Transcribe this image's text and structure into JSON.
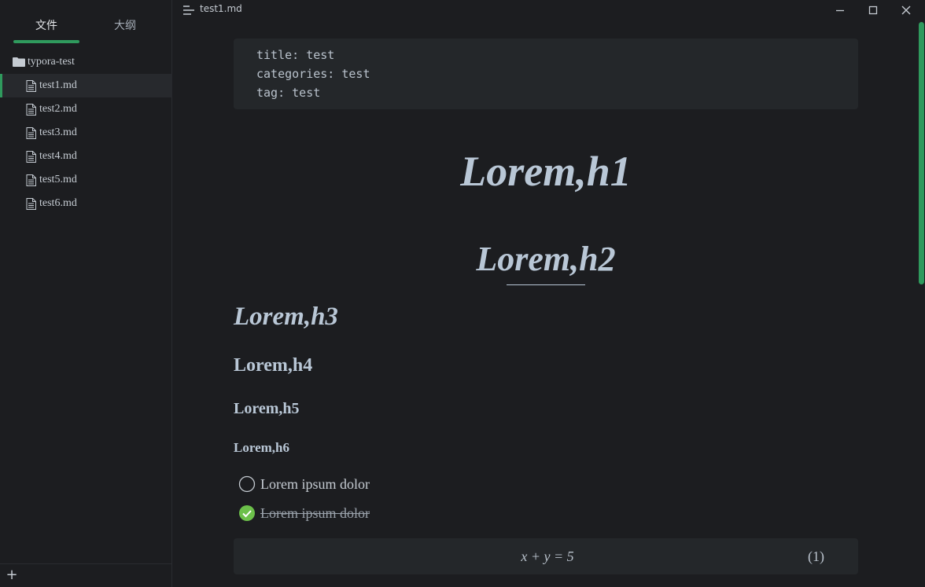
{
  "sidebar": {
    "tabs": {
      "files": "文件",
      "outline": "大纲"
    },
    "folder": {
      "name": "typora-test",
      "icon": "folder-icon"
    },
    "files": [
      {
        "name": "test1.md",
        "active": true
      },
      {
        "name": "test2.md",
        "active": false
      },
      {
        "name": "test3.md",
        "active": false
      },
      {
        "name": "test4.md",
        "active": false
      },
      {
        "name": "test5.md",
        "active": false
      },
      {
        "name": "test6.md",
        "active": false
      }
    ],
    "add_label": "+"
  },
  "titlebar": {
    "title": "test1.md"
  },
  "document": {
    "frontmatter": [
      {
        "key": "title:",
        "value": "test"
      },
      {
        "key": "categories:",
        "value": "test"
      },
      {
        "key": "tag:",
        "value": "test"
      }
    ],
    "h1": "Lorem,h1",
    "h2": "Lorem,h2",
    "h3": "Lorem,h3",
    "h4": "Lorem,h4",
    "h5": "Lorem,h5",
    "h6": "Lorem,h6",
    "tasks": [
      {
        "text": "Lorem ipsum dolor",
        "done": false
      },
      {
        "text": "Lorem ipsum dolor",
        "done": true
      }
    ],
    "math": {
      "expression": "x + y = 5",
      "number": "(1)"
    }
  },
  "colors": {
    "accent": "#2f9a5d",
    "check": "#6cc04a",
    "background": "#1c1d20",
    "block": "#24272a"
  }
}
